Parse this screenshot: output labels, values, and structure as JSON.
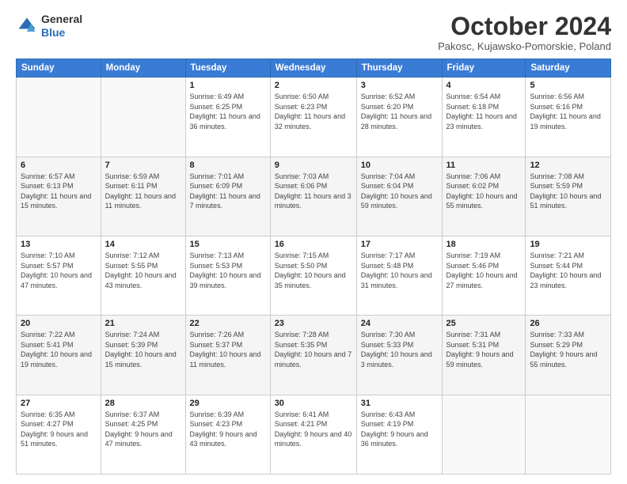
{
  "header": {
    "logo_general": "General",
    "logo_blue": "Blue",
    "month_title": "October 2024",
    "subtitle": "Pakosc, Kujawsko-Pomorskie, Poland"
  },
  "columns": [
    "Sunday",
    "Monday",
    "Tuesday",
    "Wednesday",
    "Thursday",
    "Friday",
    "Saturday"
  ],
  "weeks": [
    [
      {
        "day": "",
        "info": ""
      },
      {
        "day": "",
        "info": ""
      },
      {
        "day": "1",
        "info": "Sunrise: 6:49 AM\nSunset: 6:25 PM\nDaylight: 11 hours and 36 minutes."
      },
      {
        "day": "2",
        "info": "Sunrise: 6:50 AM\nSunset: 6:23 PM\nDaylight: 11 hours and 32 minutes."
      },
      {
        "day": "3",
        "info": "Sunrise: 6:52 AM\nSunset: 6:20 PM\nDaylight: 11 hours and 28 minutes."
      },
      {
        "day": "4",
        "info": "Sunrise: 6:54 AM\nSunset: 6:18 PM\nDaylight: 11 hours and 23 minutes."
      },
      {
        "day": "5",
        "info": "Sunrise: 6:56 AM\nSunset: 6:16 PM\nDaylight: 11 hours and 19 minutes."
      }
    ],
    [
      {
        "day": "6",
        "info": "Sunrise: 6:57 AM\nSunset: 6:13 PM\nDaylight: 11 hours and 15 minutes."
      },
      {
        "day": "7",
        "info": "Sunrise: 6:59 AM\nSunset: 6:11 PM\nDaylight: 11 hours and 11 minutes."
      },
      {
        "day": "8",
        "info": "Sunrise: 7:01 AM\nSunset: 6:09 PM\nDaylight: 11 hours and 7 minutes."
      },
      {
        "day": "9",
        "info": "Sunrise: 7:03 AM\nSunset: 6:06 PM\nDaylight: 11 hours and 3 minutes."
      },
      {
        "day": "10",
        "info": "Sunrise: 7:04 AM\nSunset: 6:04 PM\nDaylight: 10 hours and 59 minutes."
      },
      {
        "day": "11",
        "info": "Sunrise: 7:06 AM\nSunset: 6:02 PM\nDaylight: 10 hours and 55 minutes."
      },
      {
        "day": "12",
        "info": "Sunrise: 7:08 AM\nSunset: 5:59 PM\nDaylight: 10 hours and 51 minutes."
      }
    ],
    [
      {
        "day": "13",
        "info": "Sunrise: 7:10 AM\nSunset: 5:57 PM\nDaylight: 10 hours and 47 minutes."
      },
      {
        "day": "14",
        "info": "Sunrise: 7:12 AM\nSunset: 5:55 PM\nDaylight: 10 hours and 43 minutes."
      },
      {
        "day": "15",
        "info": "Sunrise: 7:13 AM\nSunset: 5:53 PM\nDaylight: 10 hours and 39 minutes."
      },
      {
        "day": "16",
        "info": "Sunrise: 7:15 AM\nSunset: 5:50 PM\nDaylight: 10 hours and 35 minutes."
      },
      {
        "day": "17",
        "info": "Sunrise: 7:17 AM\nSunset: 5:48 PM\nDaylight: 10 hours and 31 minutes."
      },
      {
        "day": "18",
        "info": "Sunrise: 7:19 AM\nSunset: 5:46 PM\nDaylight: 10 hours and 27 minutes."
      },
      {
        "day": "19",
        "info": "Sunrise: 7:21 AM\nSunset: 5:44 PM\nDaylight: 10 hours and 23 minutes."
      }
    ],
    [
      {
        "day": "20",
        "info": "Sunrise: 7:22 AM\nSunset: 5:41 PM\nDaylight: 10 hours and 19 minutes."
      },
      {
        "day": "21",
        "info": "Sunrise: 7:24 AM\nSunset: 5:39 PM\nDaylight: 10 hours and 15 minutes."
      },
      {
        "day": "22",
        "info": "Sunrise: 7:26 AM\nSunset: 5:37 PM\nDaylight: 10 hours and 11 minutes."
      },
      {
        "day": "23",
        "info": "Sunrise: 7:28 AM\nSunset: 5:35 PM\nDaylight: 10 hours and 7 minutes."
      },
      {
        "day": "24",
        "info": "Sunrise: 7:30 AM\nSunset: 5:33 PM\nDaylight: 10 hours and 3 minutes."
      },
      {
        "day": "25",
        "info": "Sunrise: 7:31 AM\nSunset: 5:31 PM\nDaylight: 9 hours and 59 minutes."
      },
      {
        "day": "26",
        "info": "Sunrise: 7:33 AM\nSunset: 5:29 PM\nDaylight: 9 hours and 55 minutes."
      }
    ],
    [
      {
        "day": "27",
        "info": "Sunrise: 6:35 AM\nSunset: 4:27 PM\nDaylight: 9 hours and 51 minutes."
      },
      {
        "day": "28",
        "info": "Sunrise: 6:37 AM\nSunset: 4:25 PM\nDaylight: 9 hours and 47 minutes."
      },
      {
        "day": "29",
        "info": "Sunrise: 6:39 AM\nSunset: 4:23 PM\nDaylight: 9 hours and 43 minutes."
      },
      {
        "day": "30",
        "info": "Sunrise: 6:41 AM\nSunset: 4:21 PM\nDaylight: 9 hours and 40 minutes."
      },
      {
        "day": "31",
        "info": "Sunrise: 6:43 AM\nSunset: 4:19 PM\nDaylight: 9 hours and 36 minutes."
      },
      {
        "day": "",
        "info": ""
      },
      {
        "day": "",
        "info": ""
      }
    ]
  ]
}
